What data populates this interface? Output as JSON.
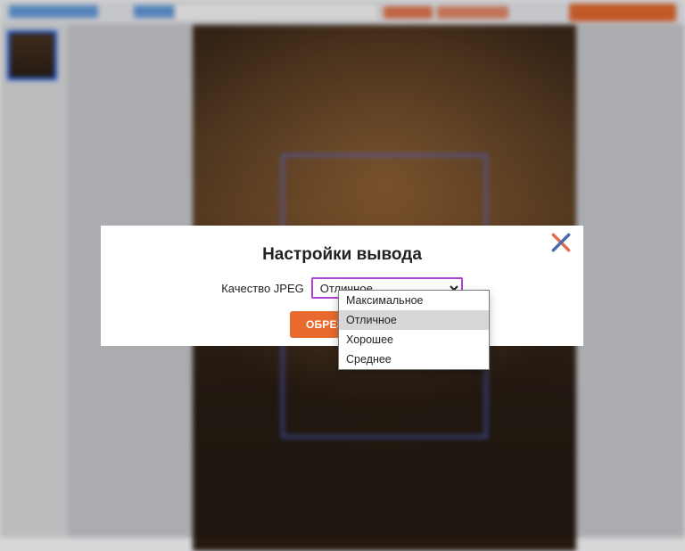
{
  "modal": {
    "title": "Настройки вывода",
    "quality_label": "Качество JPEG",
    "selected": "Отличное",
    "options": [
      "Максимальное",
      "Отличное",
      "Хорошее",
      "Среднее"
    ],
    "crop_button": "ОБРЕЗАТЬ Ф"
  }
}
